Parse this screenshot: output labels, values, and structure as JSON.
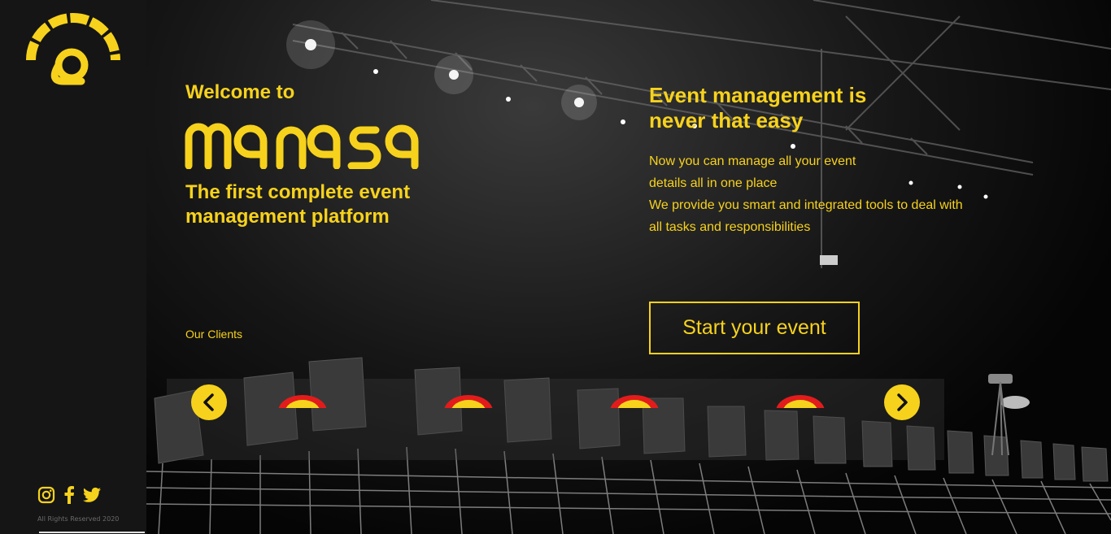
{
  "sidebar": {
    "social": [
      "instagram-icon",
      "facebook-icon",
      "twitter-icon"
    ],
    "rights": "All Rights Reserved 2020"
  },
  "hero": {
    "welcome": "Welcome to",
    "brand": "manasa",
    "tagline": "The first complete event management platform"
  },
  "event": {
    "title": "Event management is never that easy",
    "desc_lines": [
      "Now you can manage all your event",
      "details all in one place",
      "We provide you smart and integrated tools to deal with",
      "all tasks and responsibilities"
    ],
    "cta": "Start your event"
  },
  "clients": {
    "label": "Our Clients",
    "logos": [
      "shell-logo",
      "shell-logo",
      "shell-logo",
      "shell-logo"
    ]
  },
  "colors": {
    "accent": "#f7d21c",
    "sidebar_bg": "#151515",
    "logo_red": "#e21c1c"
  }
}
